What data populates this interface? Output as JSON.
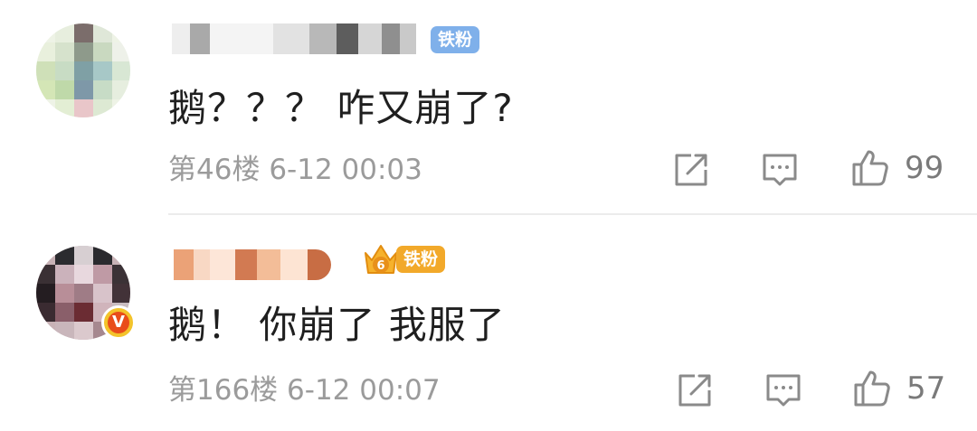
{
  "comments": [
    {
      "fan_badge": "铁粉",
      "text": "鹅？？？ 咋又崩了?",
      "floor": "第46楼",
      "date": "6-12",
      "time": "00:03",
      "likes": "99",
      "icons": [
        "share-icon",
        "reply-icon",
        "like-icon"
      ]
    },
    {
      "fan_badge": "铁粉",
      "fan_level": "6",
      "verified_mark": "V",
      "text": "鹅！ 你崩了 我服了",
      "floor": "第166楼",
      "date": "6-12",
      "time": "00:07",
      "likes": "57",
      "icons": [
        "share-icon",
        "reply-icon",
        "like-icon"
      ]
    }
  ],
  "colors": {
    "text": "#1f1f1f",
    "meta": "#9b9b9b",
    "fan_badge_1": "#7fb0ea",
    "fan_badge_2": "#f2a92a",
    "verified": "#e94d1a"
  }
}
